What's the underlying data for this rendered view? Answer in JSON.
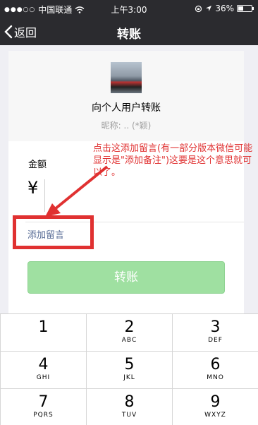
{
  "status_bar": {
    "dots": "●●●○○",
    "carrier": "中国联通",
    "time": "上午3:00",
    "battery": "36%"
  },
  "nav": {
    "back_label": "返回",
    "title": "转账"
  },
  "recipient": {
    "title": "向个人用户转账",
    "nickname": "昵称: .. (*颖)"
  },
  "form": {
    "amount_label": "金额",
    "currency": "¥",
    "add_message": "添加留言",
    "transfer_button": "转账"
  },
  "annotation": {
    "text": "点击这添加留言(有一部分版本微信可能显示是\"添加备注\")这要是这个意思就可以了。"
  },
  "keypad": {
    "keys": [
      {
        "num": "1",
        "letters": ""
      },
      {
        "num": "2",
        "letters": "ABC"
      },
      {
        "num": "3",
        "letters": "DEF"
      },
      {
        "num": "4",
        "letters": "GHI"
      },
      {
        "num": "5",
        "letters": "JKL"
      },
      {
        "num": "6",
        "letters": "MNO"
      },
      {
        "num": "7",
        "letters": "PQRS"
      },
      {
        "num": "8",
        "letters": "TUV"
      },
      {
        "num": "9",
        "letters": "WXYZ"
      }
    ]
  },
  "colors": {
    "nav_bg": "#2b2b2f",
    "button_green": "#9fe0a1",
    "link_blue": "#576b95",
    "annotation_red": "#e03131"
  }
}
